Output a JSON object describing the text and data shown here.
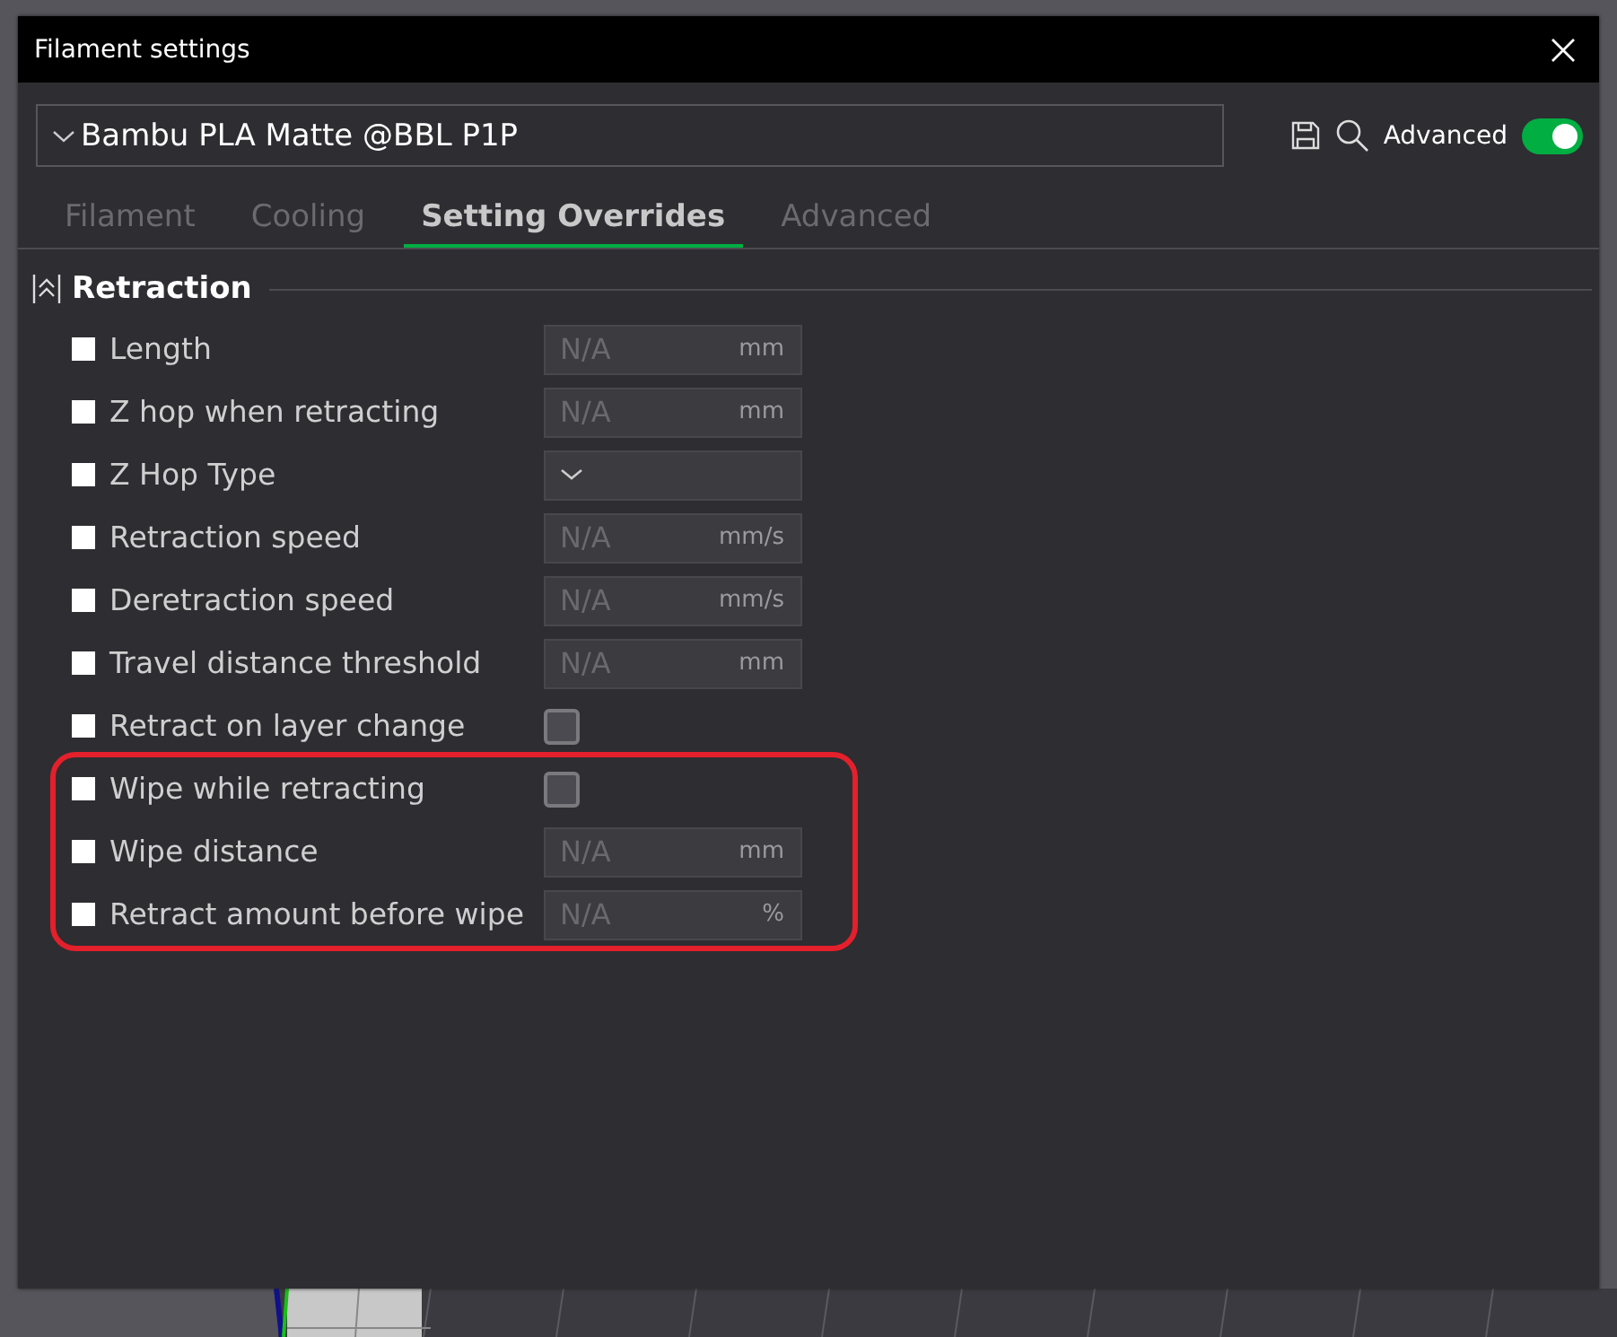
{
  "window": {
    "title": "Filament settings"
  },
  "preset": {
    "name": "Bambu PLA Matte @BBL P1P"
  },
  "advanced": {
    "label": "Advanced",
    "on": true
  },
  "tabs": [
    {
      "label": "Filament",
      "selected": false
    },
    {
      "label": "Cooling",
      "selected": false
    },
    {
      "label": "Setting Overrides",
      "selected": true
    },
    {
      "label": "Advanced",
      "selected": false
    }
  ],
  "section": {
    "title": "Retraction"
  },
  "options": [
    {
      "kind": "number",
      "label": "Length",
      "override": false,
      "value": "N/A",
      "unit": "mm",
      "highlighted": false
    },
    {
      "kind": "number",
      "label": "Z hop when retracting",
      "override": false,
      "value": "N/A",
      "unit": "mm",
      "highlighted": false
    },
    {
      "kind": "dropdown",
      "label": "Z Hop Type",
      "override": false,
      "highlighted": false
    },
    {
      "kind": "number",
      "label": "Retraction speed",
      "override": false,
      "value": "N/A",
      "unit": "mm/s",
      "highlighted": false
    },
    {
      "kind": "number",
      "label": "Deretraction speed",
      "override": false,
      "value": "N/A",
      "unit": "mm/s",
      "highlighted": false
    },
    {
      "kind": "number",
      "label": "Travel distance threshold",
      "override": false,
      "value": "N/A",
      "unit": "mm",
      "highlighted": false
    },
    {
      "kind": "checkbox",
      "label": "Retract on layer change",
      "override": false,
      "checked": false,
      "highlighted": false
    },
    {
      "kind": "checkbox",
      "label": "Wipe while retracting",
      "override": false,
      "checked": false,
      "highlighted": true
    },
    {
      "kind": "number",
      "label": "Wipe distance",
      "override": false,
      "value": "N/A",
      "unit": "mm",
      "highlighted": true
    },
    {
      "kind": "number",
      "label": "Retract amount before wipe",
      "override": false,
      "value": "N/A",
      "unit": "%",
      "highlighted": true
    }
  ]
}
